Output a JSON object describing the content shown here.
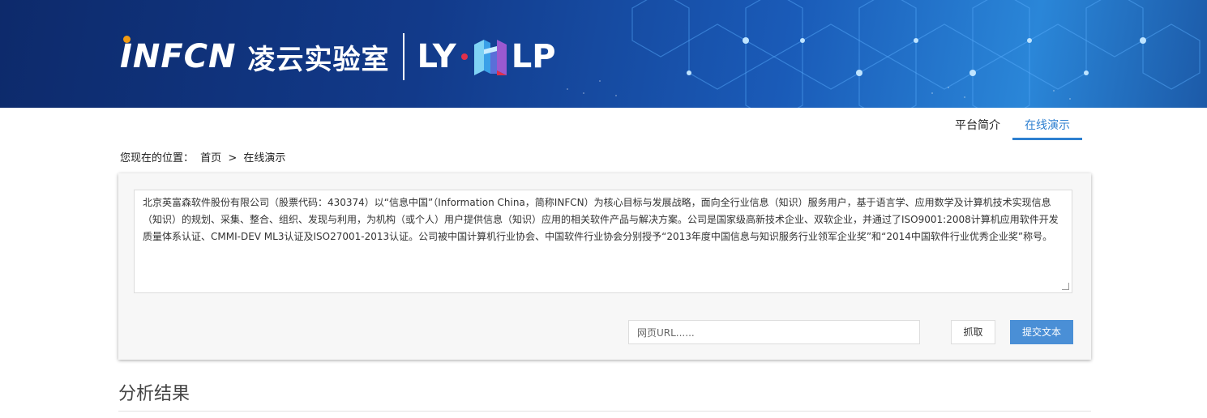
{
  "banner": {
    "brand": "INFCN",
    "brand_cn": "凌云实验室",
    "brand_ly": "LY",
    "brand_lp": "LP",
    "accent_orange": "#f39c12",
    "accent_red": "#e0304a"
  },
  "nav": {
    "items": [
      {
        "label": "平台简介"
      },
      {
        "label": "在线演示"
      }
    ],
    "active_color": "#2d7fd0"
  },
  "breadcrumb": {
    "prefix": "您现在的位置：",
    "home": "首页",
    "separator": ">",
    "current": "在线演示"
  },
  "input": {
    "text": "北京英富森软件股份有限公司（股票代码：430374）以“信息中国”（Information China，简称INFCN）为核心目标与发展战略，面向全行业信息（知识）服务用户，基于语言学、应用数学及计算机技术实现信息（知识）的规划、采集、整合、组织、发现与利用，为机构（或个人）用户提供信息（知识）应用的相关软件产品与解决方案。公司是国家级高新技术企业、双软企业，并通过了ISO9001:2008计算机应用软件开发质量体系认证、CMMI-DEV ML3认证及ISO27001-2013认证。公司被中国计算机行业协会、中国软件行业协会分别授予“2013年度中国信息与知识服务行业领军企业奖”和“2014中国软件行业优秀企业奖”称号。",
    "url_placeholder": "网页URL......",
    "fetch_label": "抓取",
    "submit_label": "提交文本",
    "submit_color": "#4a8fd6"
  },
  "results": {
    "title": "分析结果"
  }
}
